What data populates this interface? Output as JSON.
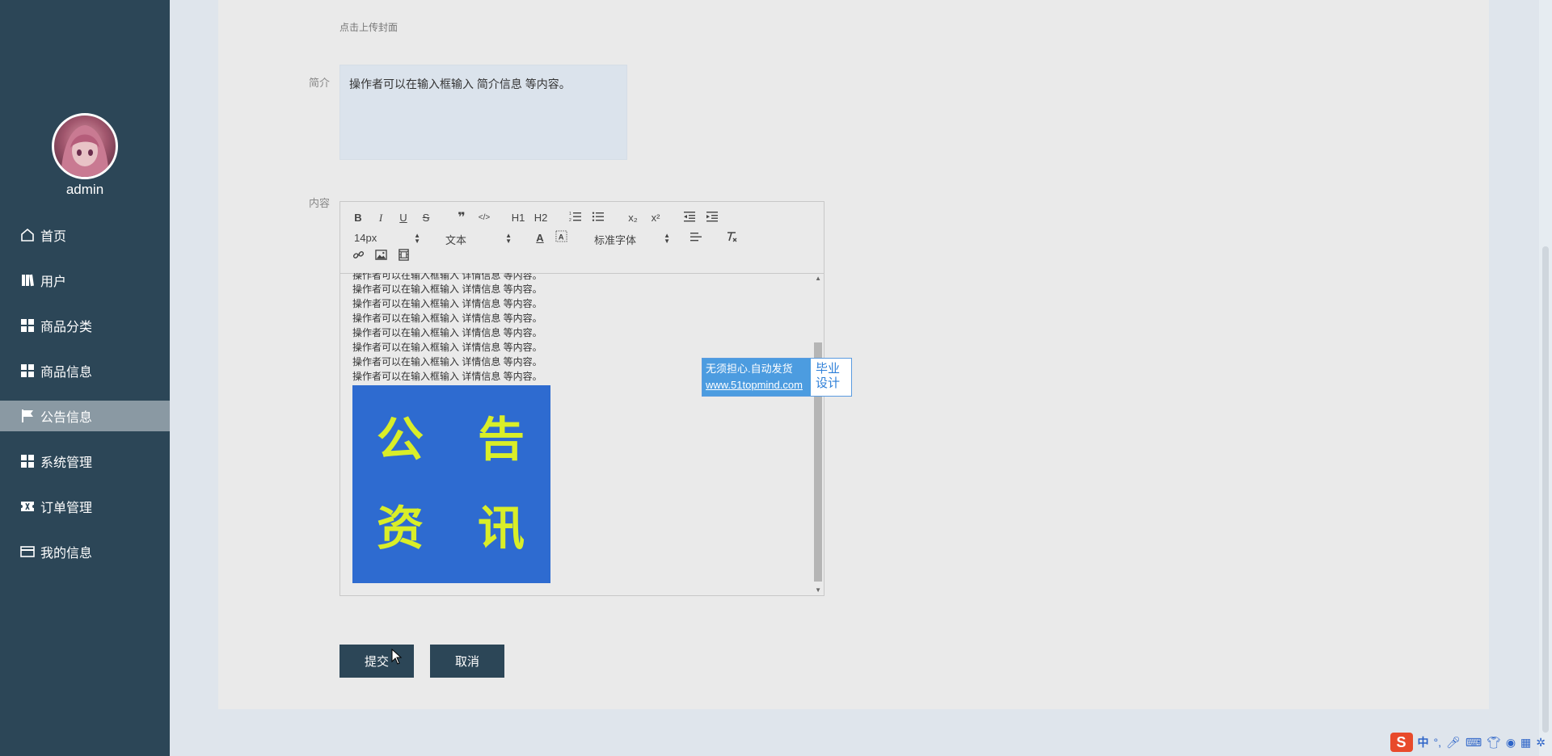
{
  "sidebar": {
    "username": "admin",
    "items": [
      {
        "label": "首页",
        "icon": "home-icon"
      },
      {
        "label": "用户",
        "icon": "book-icon"
      },
      {
        "label": "商品分类",
        "icon": "grid-icon"
      },
      {
        "label": "商品信息",
        "icon": "grid-icon"
      },
      {
        "label": "公告信息",
        "icon": "flag-icon",
        "active": true
      },
      {
        "label": "系统管理",
        "icon": "grid-icon"
      },
      {
        "label": "订单管理",
        "icon": "ticket-icon"
      },
      {
        "label": "我的信息",
        "icon": "card-icon"
      }
    ]
  },
  "form": {
    "cover_hint": "点击上传封面",
    "intro_label": "简介",
    "intro_value": "操作者可以在输入框输入    简介信息      等内容。",
    "content_label": "内容",
    "submit_label": "提交",
    "cancel_label": "取消"
  },
  "editor": {
    "toolbar": {
      "buttons_row1": [
        "B",
        "I",
        "U",
        "S",
        "❞",
        "</>",
        "H1",
        "H2",
        "ol",
        "ul",
        "x₂",
        "x²",
        "outdent",
        "indent"
      ],
      "font_size": "14px",
      "paragraph": "文本",
      "font_family": "标准字体"
    },
    "lines": [
      "操作者可以在输入框输入  详情信息  等内容。",
      "操作者可以在输入框输入  详情信息  等内容。",
      "操作者可以在输入框输入  详情信息  等内容。",
      "操作者可以在输入框输入  详情信息  等内容。",
      "操作者可以在输入框输入  详情信息  等内容。",
      "操作者可以在输入框输入  详情信息  等内容。",
      "操作者可以在输入框输入  详情信息  等内容。",
      "操作者可以在输入框输入  详情信息  等内容。"
    ],
    "banner_chars": [
      "公",
      "告",
      "资",
      "讯"
    ],
    "banner_colors": {
      "bg": "#2e6bd0",
      "text": "#d9ee28"
    }
  },
  "watermark": {
    "line1": "无须担心.自动发货",
    "line2": "www.51topmind.com",
    "right1": "毕业",
    "right2": "设计"
  },
  "tray": {
    "ime": "中"
  },
  "colors": {
    "sidebar": "#2c4657",
    "active_item": "#8a99a3",
    "panel": "#eaeaea",
    "button": "#2c4657"
  }
}
